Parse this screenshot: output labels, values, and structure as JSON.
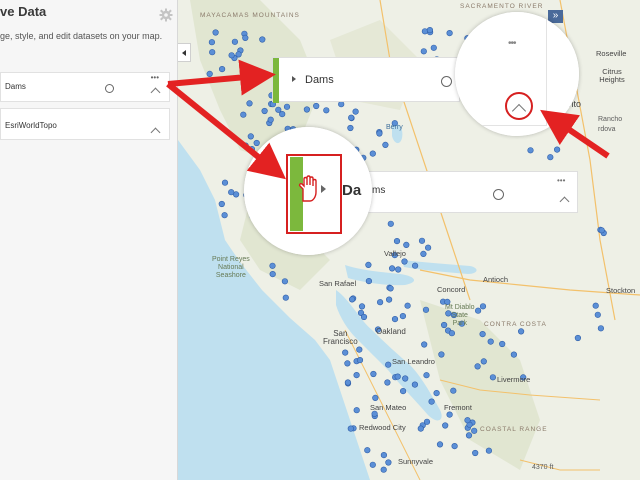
{
  "panel": {
    "title": "ve Data",
    "subtitle": "ge, style, and edit datasets on your map.",
    "settings_icon": "gear-icon",
    "collapse_icon": "caret-left-icon"
  },
  "layers": [
    {
      "name": "Dams",
      "visible_icon": "radio-circle-icon",
      "menu_icon": "ellipsis-icon",
      "toggle_icon": "chevron-up-icon"
    },
    {
      "name": "EsriWorldTopo",
      "toggle_icon": "chevron-up-icon"
    }
  ],
  "zoom_card_large": {
    "name": "Dams"
  },
  "zoom_card_hand": {
    "name": "ms",
    "name_partial": "Da"
  },
  "map_labels": {
    "sacramento_river": "SACRAMENTO RIVER",
    "mayacamas": "MAYACAMAS MOUNTAINS",
    "roseville": "Roseville",
    "citrus_heights": "Citrus\nHeights",
    "ramento": "ramento",
    "rancho": "Rancho",
    "cordova": "rdova",
    "point_reyes": "Point Reyes\nNational\nSeashore",
    "san_rafael": "San Rafael",
    "vallejo": "Vallejo",
    "antioch": "Antioch",
    "concord": "Concord",
    "mt_diablo": "Mt Diablo\nState\nPark",
    "contra_costa": "CONTRA COSTA",
    "stockton": "Stockton",
    "san_francisco": "San\nFrancisco",
    "oakland": "Oakland",
    "san_leandro": "San Leandro",
    "livermore": "Livermore",
    "san_mateo": "San Mateo",
    "fremont": "Fremont",
    "redwood_city": "Redwood City",
    "coastal_range": "COASTAL RANGE",
    "sunnyvale": "Sunnyvale",
    "berryessa": "Berry",
    "elev_4370": "4370 ft"
  },
  "toolbar": {
    "expand_icon": "double-chevron-right-icon",
    "expand_label": "»"
  },
  "colors": {
    "point": "#5b8fd6",
    "point_stroke": "#2f5ea8",
    "water": "#bfe0ef",
    "land": "#eef0e6",
    "hills": "#d9dfc8",
    "arrow": "#e32222",
    "stripe": "#7cb83d",
    "highlight": "#d62020"
  }
}
